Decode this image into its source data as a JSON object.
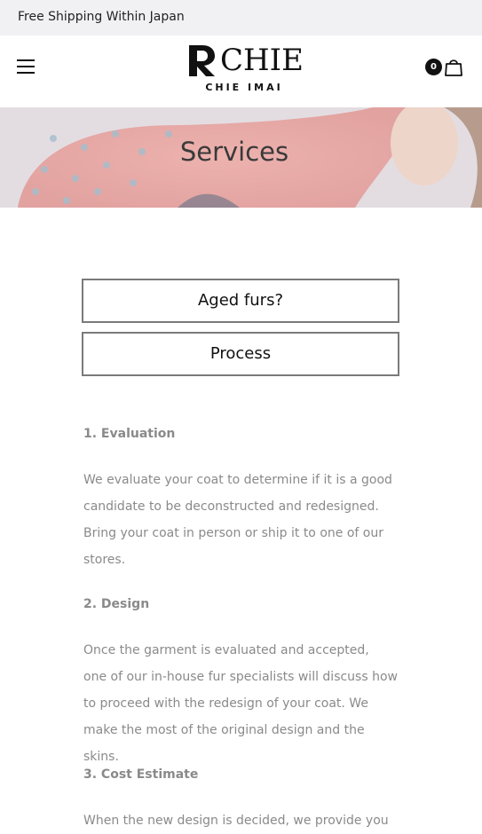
{
  "announcement": "Free Shipping Within Japan",
  "brand": {
    "name": "CHIE",
    "subtitle": "CHIE IMAI"
  },
  "cart": {
    "count": "0"
  },
  "hero": {
    "title": "Services"
  },
  "tabs": [
    {
      "label": "Aged furs?"
    },
    {
      "label": "Process"
    }
  ],
  "sections": [
    {
      "heading": "1. Evaluation",
      "lines": [
        "We evaluate your coat to determine if it is a good",
        "candidate to be deconstructed and redesigned.",
        "Bring your coat in person or ship it to one of our",
        "stores."
      ]
    },
    {
      "heading": "2. Design",
      "lines": [
        "Once the garment is evaluated and accepted,",
        "one of our in-house fur specialists will discuss how",
        "to proceed with the redesign of your coat. We",
        "make the most of the original design and the skins."
      ]
    },
    {
      "heading": "3. Cost Estimate",
      "lines": [
        "When the new design is decided, we provide you"
      ]
    }
  ]
}
